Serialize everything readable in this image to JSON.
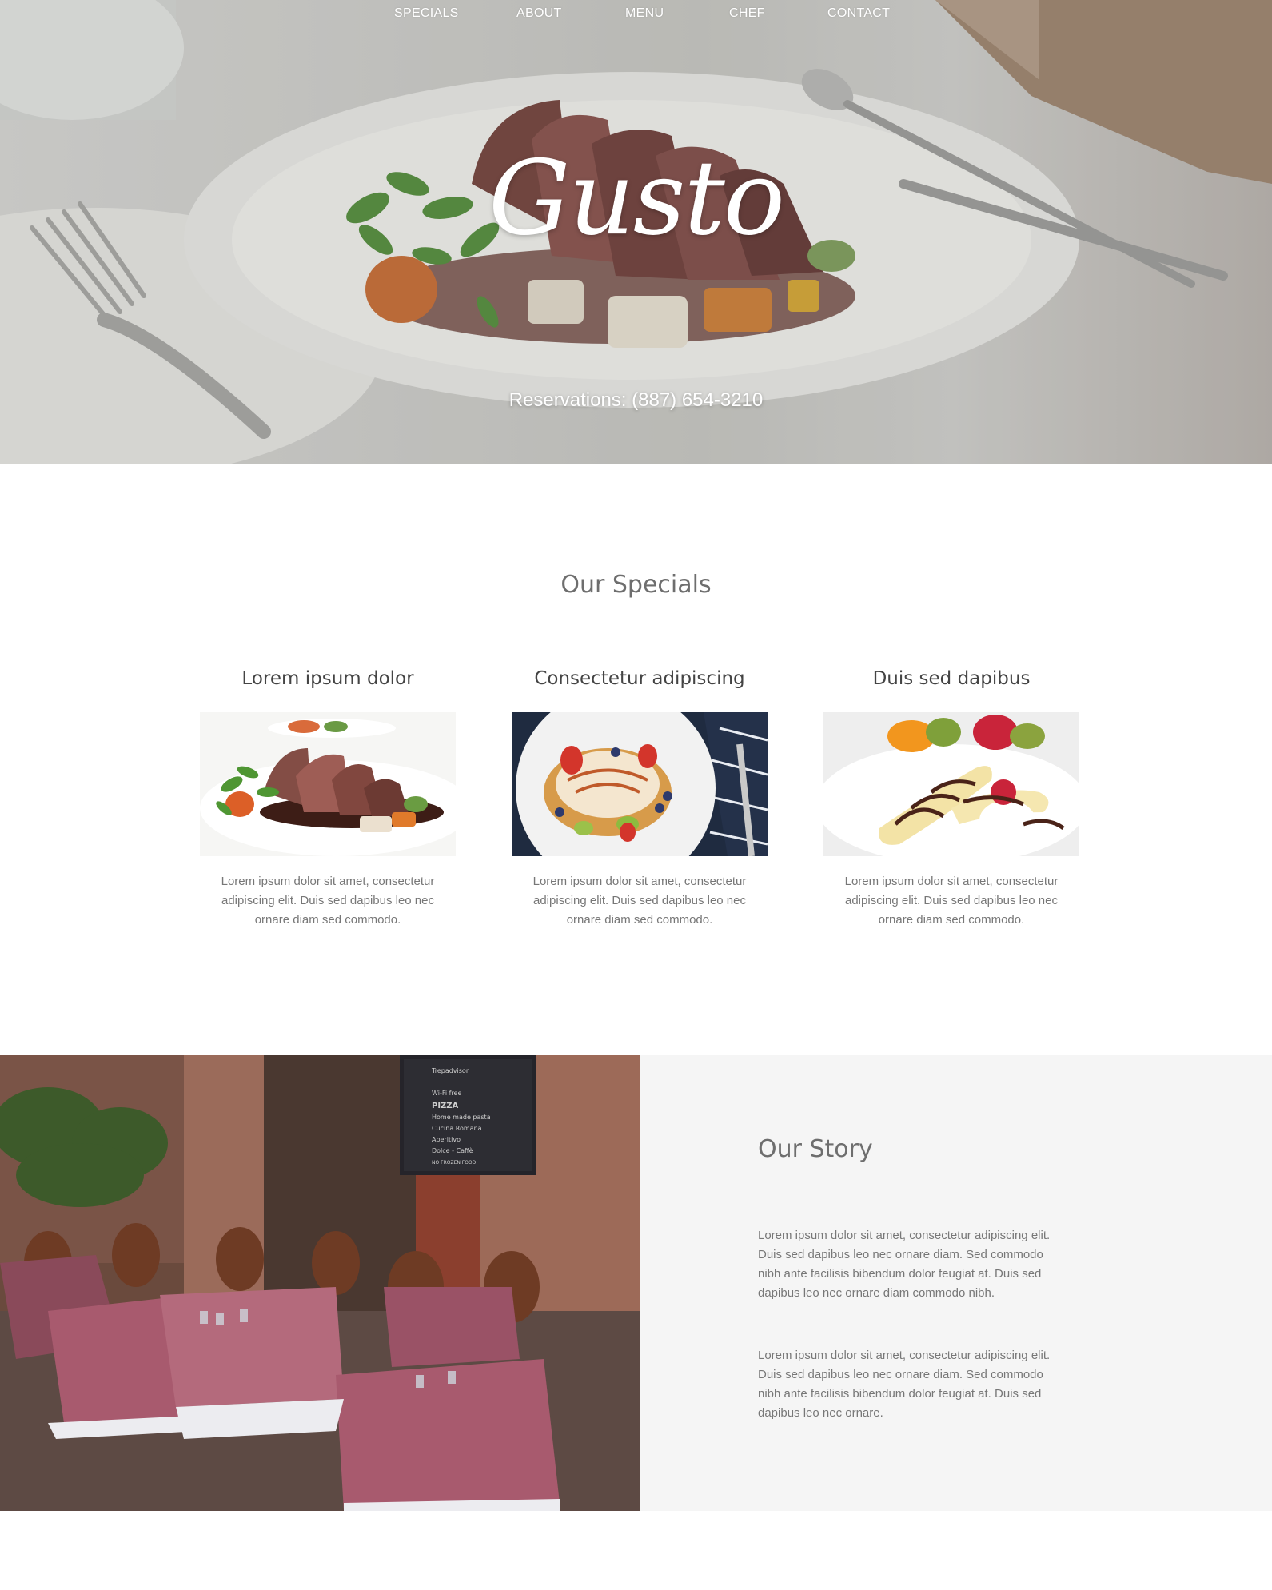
{
  "nav": {
    "items": [
      "SPECIALS",
      "ABOUT",
      "MENU",
      "CHEF",
      "CONTACT"
    ]
  },
  "hero": {
    "brand": "Gusto",
    "reservations": "Reservations: (887) 654-3210"
  },
  "specials": {
    "title": "Our Specials",
    "cards": [
      {
        "title": "Lorem ipsum dolor",
        "text": "Lorem ipsum dolor sit amet, consectetur adipiscing elit. Duis sed dapibus leo nec ornare diam sed commodo."
      },
      {
        "title": "Consectetur adipiscing",
        "text": "Lorem ipsum dolor sit amet, consectetur adipiscing elit. Duis sed dapibus leo nec ornare diam sed commodo."
      },
      {
        "title": "Duis sed dapibus",
        "text": "Lorem ipsum dolor sit amet, consectetur adipiscing elit. Duis sed dapibus leo nec ornare diam sed commodo."
      }
    ]
  },
  "story": {
    "title": "Our Story",
    "paragraphs": [
      "Lorem ipsum dolor sit amet, consectetur adipiscing elit. Duis sed dapibus leo nec ornare diam. Sed commodo nibh ante facilisis bibendum dolor feugiat at. Duis sed dapibus leo nec ornare diam commodo nibh.",
      "Lorem ipsum dolor sit amet, consectetur adipiscing elit. Duis sed dapibus leo nec ornare diam. Sed commodo nibh ante facilisis bibendum dolor feugiat at. Duis sed dapibus leo nec ornare."
    ],
    "chalkboard": [
      "Trepadvisor",
      "Wi-Fi free",
      "PIZZA",
      "Home made pasta",
      "Cucina Romana",
      "Aperitivo",
      "Dolce - Caffè",
      "NO FROZEN FOOD"
    ]
  },
  "colors": {
    "heading": "#6e6e6e",
    "body_text": "#777777",
    "panel_bg": "#f5f5f5",
    "hero_text": "#ffffff"
  },
  "icons": {
    "hero_image": "plated-steak-image",
    "special_1": "steak-dish-image",
    "special_2": "pancake-dessert-image",
    "special_3": "banana-dessert-image",
    "story_image": "restaurant-terrace-image"
  }
}
